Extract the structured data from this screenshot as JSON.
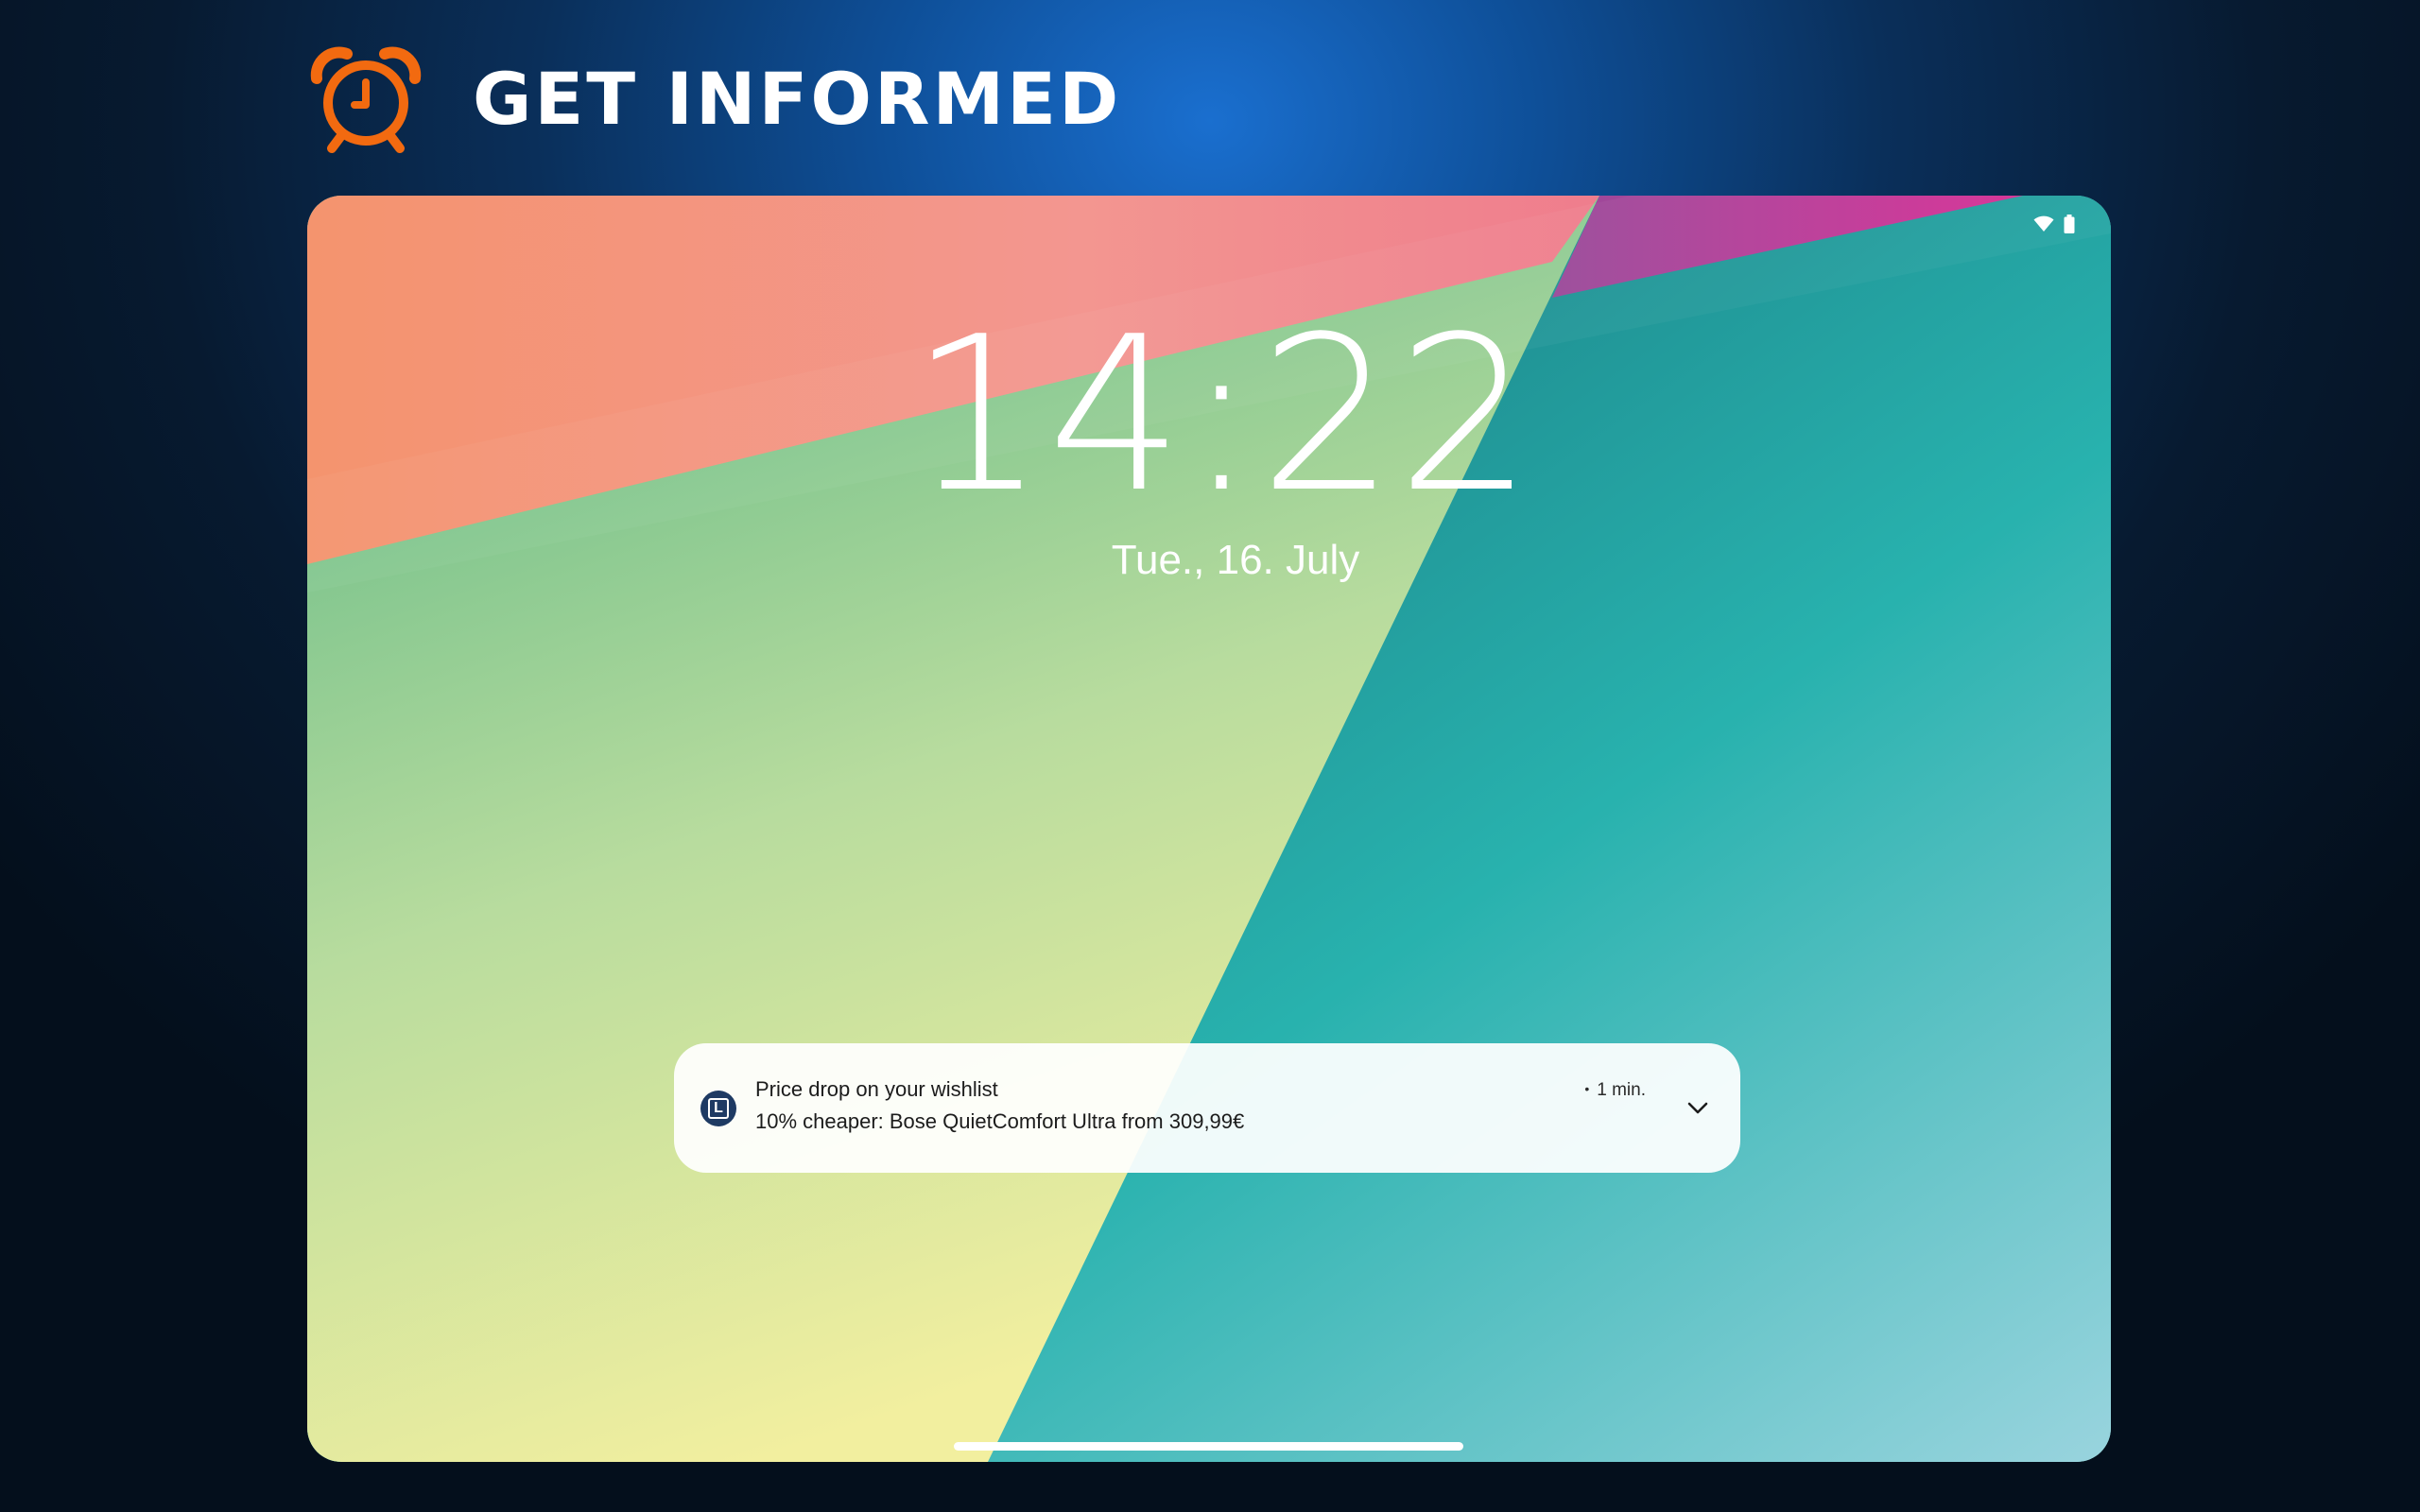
{
  "header": {
    "title": "GET INFORMED",
    "icon": "alarm-clock-icon",
    "icon_color": "#f26a10"
  },
  "lockscreen": {
    "status_bar": {
      "icons": [
        "wifi-icon",
        "battery-icon"
      ]
    },
    "time": "14:22",
    "date": "Tue., 16. July",
    "notification": {
      "app_icon": "app-logo-icon",
      "app_icon_letter": "L",
      "title": "Price drop on your wishlist",
      "body": "10% cheaper: Bose QuietComfort Ultra from 309,99€",
      "time": "1 min.",
      "expand_icon": "chevron-down-icon"
    }
  },
  "colors": {
    "page_background": "#071a30",
    "page_glow": "#1a6fcf",
    "accent_orange": "#f26a10",
    "wallpaper_salmon": "#f6957a",
    "wallpaper_pink": "#d43a96",
    "wallpaper_green": "#86c98c",
    "wallpaper_yellow": "#eeee9f",
    "wallpaper_teal": "#22b3b0",
    "wallpaper_dark_teal": "#2a6e83"
  }
}
